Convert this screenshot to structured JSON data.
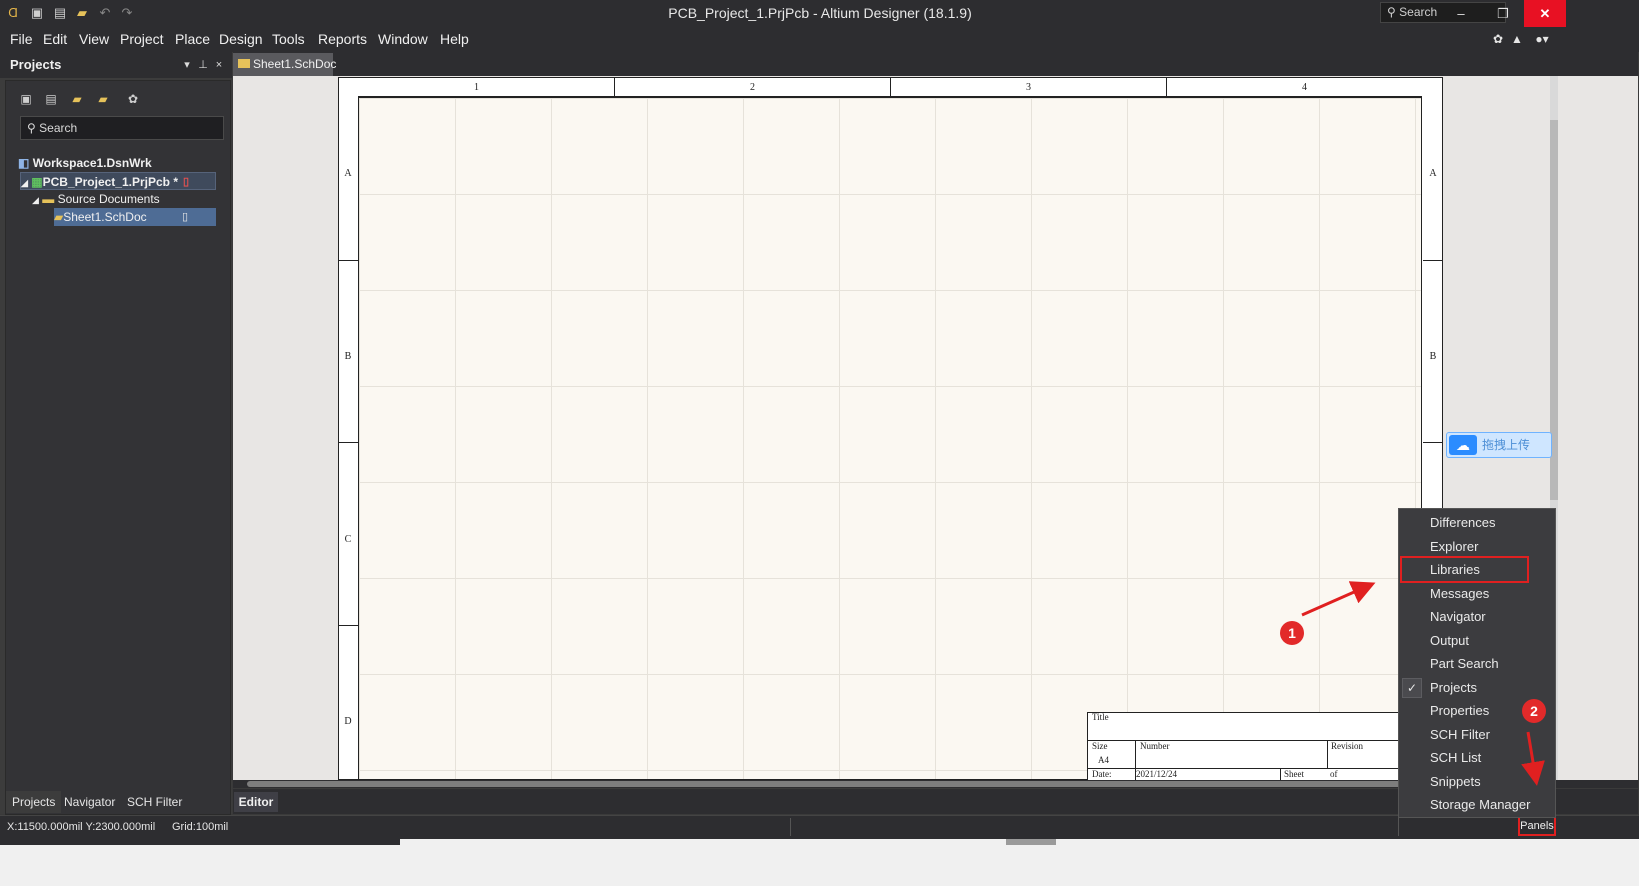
{
  "window": {
    "title": "PCB_Project_1.PrjPcb - Altium Designer (18.1.9)",
    "search_placeholder": "Search",
    "minimize_glyph": "–",
    "restore_glyph": "❐",
    "close_glyph": "✕"
  },
  "quick_access": {
    "icons": [
      "app-icon",
      "save-icon",
      "save-all-icon",
      "open-icon",
      "undo-icon",
      "redo-icon"
    ]
  },
  "menu": {
    "items": [
      "File",
      "Edit",
      "View",
      "Project",
      "Place",
      "Design",
      "Tools",
      "Reports",
      "Window",
      "Help"
    ]
  },
  "projects_panel": {
    "title": "Projects",
    "search_placeholder": "Search",
    "tree": {
      "workspace": "Workspace1.DsnWrk",
      "project": "PCB_Project_1.PrjPcb *",
      "folder": "Source Documents",
      "document": "Sheet1.SchDoc"
    },
    "bottom_tabs": [
      "Projects",
      "Navigator",
      "SCH Filter"
    ]
  },
  "document": {
    "tab_label": "Sheet1.SchDoc",
    "editor_tab": "Editor",
    "zones_cols": [
      "1",
      "2",
      "3",
      "4"
    ],
    "zones_rows": [
      "A",
      "B",
      "C",
      "D"
    ],
    "title_block": {
      "title_label": "Title",
      "size_label": "Size",
      "size_value": "A4",
      "number_label": "Number",
      "revision_label": "Revision",
      "date_label": "Date:",
      "date_value": "2021/12/24",
      "sheet_label": "Sheet",
      "of_label": "of"
    }
  },
  "status": {
    "coords": "X:11500.000mil Y:2300.000mil",
    "grid": "Grid:100mil",
    "panels_button": "Panels"
  },
  "cloud_widget": {
    "label": "拖拽上传"
  },
  "panels_menu": {
    "items": [
      "Differences",
      "Explorer",
      "Libraries",
      "Messages",
      "Navigator",
      "Output",
      "Part Search",
      "Projects",
      "Properties",
      "SCH Filter",
      "SCH List",
      "Snippets",
      "Storage Manager"
    ],
    "checked": "Projects",
    "highlighted": "Libraries"
  },
  "annotations": {
    "callout_1": "1",
    "callout_2": "2"
  },
  "colors": {
    "chrome": "#2d2d30",
    "panel": "#3c3c3c",
    "selection": "#4e6c95",
    "annotation_red": "#e02020"
  }
}
